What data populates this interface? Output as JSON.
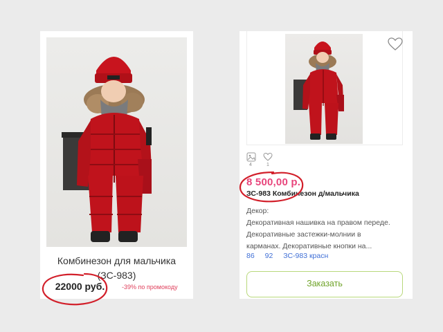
{
  "left_card": {
    "title_line1": "Комбинезон для мальчика",
    "title_line2": "(ЗС-983)",
    "price": "22000 руб.",
    "promo": "-39% по промокоду"
  },
  "right_card": {
    "photos_count": "4",
    "likes_count": "1",
    "price": "8 500,00 р.",
    "product_name": "ЗС-983 Комбинезон д/мальчика",
    "description": {
      "heading": "Декор:",
      "line1": "Декоративная нашивка на правом переде.",
      "line2": "Декоративные застежки-молнии в",
      "line3": "карманах. Декоративные кнопки на..."
    },
    "tags": [
      "86",
      "92",
      "ЗС-983 красн"
    ],
    "order_button": "Заказать"
  },
  "colors": {
    "price_pink": "#e8457c",
    "annotation_red": "#d21f2a",
    "button_green": "#6fa329",
    "link_blue": "#3f6fd6"
  }
}
